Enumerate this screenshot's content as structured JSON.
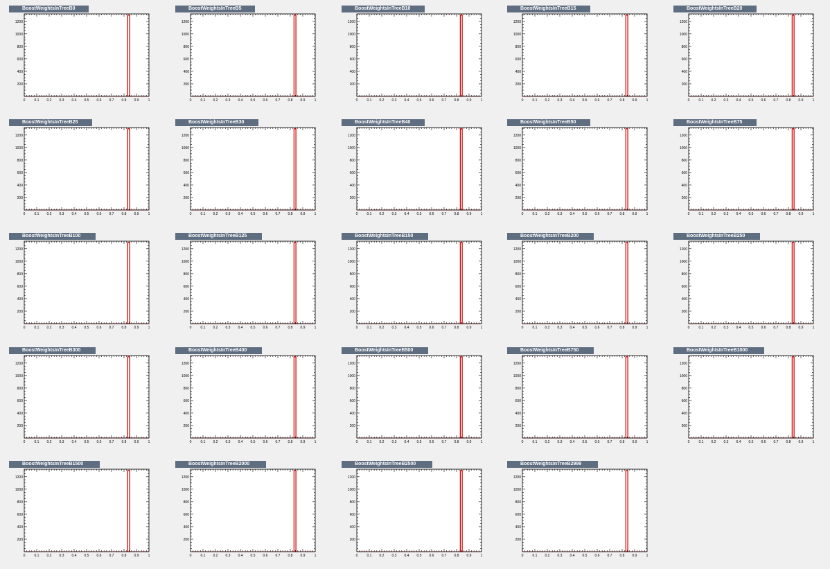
{
  "style": {
    "title_bg": "#5f6d80",
    "title_fg": "#ffffff",
    "frame": "#000000",
    "histogram_line": "#cc0000",
    "baseline": "#cc0000"
  },
  "chart_data": [
    {
      "type": "bar",
      "title": "BoostWeightsInTreeB0",
      "x_ticks": [
        "0",
        "0.1",
        "0.2",
        "0.3",
        "0.4",
        "0.5",
        "0.6",
        "0.7",
        "0.8",
        "0.9",
        "1"
      ],
      "y_ticks": [
        "200",
        "400",
        "600",
        "800",
        "1000",
        "1200"
      ],
      "xlim": [
        0,
        1
      ],
      "ylim": [
        0,
        1320
      ],
      "bins": [
        {
          "x0": 0.83,
          "x1": 0.845,
          "value": 1300
        }
      ]
    },
    {
      "type": "bar",
      "title": "BoostWeightsInTreeB5",
      "x_ticks": [
        "0",
        "0.1",
        "0.2",
        "0.3",
        "0.4",
        "0.5",
        "0.6",
        "0.7",
        "0.8",
        "0.9",
        "1"
      ],
      "y_ticks": [
        "200",
        "400",
        "600",
        "800",
        "1000",
        "1200"
      ],
      "xlim": [
        0,
        1
      ],
      "ylim": [
        0,
        1320
      ],
      "bins": [
        {
          "x0": 0.83,
          "x1": 0.845,
          "value": 1300
        }
      ]
    },
    {
      "type": "bar",
      "title": "BoostWeightsInTreeB10",
      "x_ticks": [
        "0",
        "0.1",
        "0.2",
        "0.3",
        "0.4",
        "0.5",
        "0.6",
        "0.7",
        "0.8",
        "0.9",
        "1"
      ],
      "y_ticks": [
        "200",
        "400",
        "600",
        "800",
        "1000",
        "1200"
      ],
      "xlim": [
        0,
        1
      ],
      "ylim": [
        0,
        1320
      ],
      "bins": [
        {
          "x0": 0.83,
          "x1": 0.845,
          "value": 1300
        }
      ]
    },
    {
      "type": "bar",
      "title": "BoostWeightsInTreeB15",
      "x_ticks": [
        "0",
        "0.1",
        "0.2",
        "0.3",
        "0.4",
        "0.5",
        "0.6",
        "0.7",
        "0.8",
        "0.9",
        "1"
      ],
      "y_ticks": [
        "200",
        "400",
        "600",
        "800",
        "1000",
        "1200"
      ],
      "xlim": [
        0,
        1
      ],
      "ylim": [
        0,
        1320
      ],
      "bins": [
        {
          "x0": 0.83,
          "x1": 0.845,
          "value": 1300
        }
      ]
    },
    {
      "type": "bar",
      "title": "BoostWeightsInTreeB20",
      "x_ticks": [
        "0",
        "0.1",
        "0.2",
        "0.3",
        "0.4",
        "0.5",
        "0.6",
        "0.7",
        "0.8",
        "0.9",
        "1"
      ],
      "y_ticks": [
        "200",
        "400",
        "600",
        "800",
        "1000",
        "1200"
      ],
      "xlim": [
        0,
        1
      ],
      "ylim": [
        0,
        1320
      ],
      "bins": [
        {
          "x0": 0.83,
          "x1": 0.845,
          "value": 1300
        }
      ]
    },
    {
      "type": "bar",
      "title": "BoostWeightsInTreeB25",
      "x_ticks": [
        "0",
        "0.1",
        "0.2",
        "0.3",
        "0.4",
        "0.5",
        "0.6",
        "0.7",
        "0.8",
        "0.9",
        "1"
      ],
      "y_ticks": [
        "200",
        "400",
        "600",
        "800",
        "1000",
        "1200"
      ],
      "xlim": [
        0,
        1
      ],
      "ylim": [
        0,
        1320
      ],
      "bins": [
        {
          "x0": 0.83,
          "x1": 0.845,
          "value": 1300
        }
      ]
    },
    {
      "type": "bar",
      "title": "BoostWeightsInTreeB30",
      "x_ticks": [
        "0",
        "0.1",
        "0.2",
        "0.3",
        "0.4",
        "0.5",
        "0.6",
        "0.7",
        "0.8",
        "0.9",
        "1"
      ],
      "y_ticks": [
        "200",
        "400",
        "600",
        "800",
        "1000",
        "1200"
      ],
      "xlim": [
        0,
        1
      ],
      "ylim": [
        0,
        1320
      ],
      "bins": [
        {
          "x0": 0.83,
          "x1": 0.845,
          "value": 1300
        }
      ]
    },
    {
      "type": "bar",
      "title": "BoostWeightsInTreeB40",
      "x_ticks": [
        "0",
        "0.1",
        "0.2",
        "0.3",
        "0.4",
        "0.5",
        "0.6",
        "0.7",
        "0.8",
        "0.9",
        "1"
      ],
      "y_ticks": [
        "200",
        "400",
        "600",
        "800",
        "1000",
        "1200"
      ],
      "xlim": [
        0,
        1
      ],
      "ylim": [
        0,
        1320
      ],
      "bins": [
        {
          "x0": 0.83,
          "x1": 0.845,
          "value": 1300
        }
      ]
    },
    {
      "type": "bar",
      "title": "BoostWeightsInTreeB50",
      "x_ticks": [
        "0",
        "0.1",
        "0.2",
        "0.3",
        "0.4",
        "0.5",
        "0.6",
        "0.7",
        "0.8",
        "0.9",
        "1"
      ],
      "y_ticks": [
        "200",
        "400",
        "600",
        "800",
        "1000",
        "1200"
      ],
      "xlim": [
        0,
        1
      ],
      "ylim": [
        0,
        1320
      ],
      "bins": [
        {
          "x0": 0.83,
          "x1": 0.845,
          "value": 1300
        }
      ]
    },
    {
      "type": "bar",
      "title": "BoostWeightsInTreeB75",
      "x_ticks": [
        "0",
        "0.1",
        "0.2",
        "0.3",
        "0.4",
        "0.5",
        "0.6",
        "0.7",
        "0.8",
        "0.9",
        "1"
      ],
      "y_ticks": [
        "200",
        "400",
        "600",
        "800",
        "1000",
        "1200"
      ],
      "xlim": [
        0,
        1
      ],
      "ylim": [
        0,
        1320
      ],
      "bins": [
        {
          "x0": 0.83,
          "x1": 0.845,
          "value": 1300
        }
      ]
    },
    {
      "type": "bar",
      "title": "BoostWeightsInTreeB100",
      "x_ticks": [
        "0",
        "0.1",
        "0.2",
        "0.3",
        "0.4",
        "0.5",
        "0.6",
        "0.7",
        "0.8",
        "0.9",
        "1"
      ],
      "y_ticks": [
        "200",
        "400",
        "600",
        "800",
        "1000",
        "1200"
      ],
      "xlim": [
        0,
        1
      ],
      "ylim": [
        0,
        1320
      ],
      "bins": [
        {
          "x0": 0.83,
          "x1": 0.845,
          "value": 1300
        }
      ]
    },
    {
      "type": "bar",
      "title": "BoostWeightsInTreeB125",
      "x_ticks": [
        "0",
        "0.1",
        "0.2",
        "0.3",
        "0.4",
        "0.5",
        "0.6",
        "0.7",
        "0.8",
        "0.9",
        "1"
      ],
      "y_ticks": [
        "200",
        "400",
        "600",
        "800",
        "1000",
        "1200"
      ],
      "xlim": [
        0,
        1
      ],
      "ylim": [
        0,
        1320
      ],
      "bins": [
        {
          "x0": 0.83,
          "x1": 0.845,
          "value": 1300
        }
      ]
    },
    {
      "type": "bar",
      "title": "BoostWeightsInTreeB150",
      "x_ticks": [
        "0",
        "0.1",
        "0.2",
        "0.3",
        "0.4",
        "0.5",
        "0.6",
        "0.7",
        "0.8",
        "0.9",
        "1"
      ],
      "y_ticks": [
        "200",
        "400",
        "600",
        "800",
        "1000",
        "1200"
      ],
      "xlim": [
        0,
        1
      ],
      "ylim": [
        0,
        1320
      ],
      "bins": [
        {
          "x0": 0.83,
          "x1": 0.845,
          "value": 1300
        }
      ]
    },
    {
      "type": "bar",
      "title": "BoostWeightsInTreeB200",
      "x_ticks": [
        "0",
        "0.1",
        "0.2",
        "0.3",
        "0.4",
        "0.5",
        "0.6",
        "0.7",
        "0.8",
        "0.9",
        "1"
      ],
      "y_ticks": [
        "200",
        "400",
        "600",
        "800",
        "1000",
        "1200"
      ],
      "xlim": [
        0,
        1
      ],
      "ylim": [
        0,
        1320
      ],
      "bins": [
        {
          "x0": 0.83,
          "x1": 0.845,
          "value": 1300
        }
      ]
    },
    {
      "type": "bar",
      "title": "BoostWeightsInTreeB250",
      "x_ticks": [
        "0",
        "0.1",
        "0.2",
        "0.3",
        "0.4",
        "0.5",
        "0.6",
        "0.7",
        "0.8",
        "0.9",
        "1"
      ],
      "y_ticks": [
        "200",
        "400",
        "600",
        "800",
        "1000",
        "1200"
      ],
      "xlim": [
        0,
        1
      ],
      "ylim": [
        0,
        1320
      ],
      "bins": [
        {
          "x0": 0.83,
          "x1": 0.845,
          "value": 1300
        }
      ]
    },
    {
      "type": "bar",
      "title": "BoostWeightsInTreeB300",
      "x_ticks": [
        "0",
        "0.1",
        "0.2",
        "0.3",
        "0.4",
        "0.5",
        "0.6",
        "0.7",
        "0.8",
        "0.9",
        "1"
      ],
      "y_ticks": [
        "200",
        "400",
        "600",
        "800",
        "1000",
        "1200"
      ],
      "xlim": [
        0,
        1
      ],
      "ylim": [
        0,
        1320
      ],
      "bins": [
        {
          "x0": 0.83,
          "x1": 0.845,
          "value": 1300
        }
      ]
    },
    {
      "type": "bar",
      "title": "BoostWeightsInTreeB400",
      "x_ticks": [
        "0",
        "0.1",
        "0.2",
        "0.3",
        "0.4",
        "0.5",
        "0.6",
        "0.7",
        "0.8",
        "0.9",
        "1"
      ],
      "y_ticks": [
        "200",
        "400",
        "600",
        "800",
        "1000",
        "1200"
      ],
      "xlim": [
        0,
        1
      ],
      "ylim": [
        0,
        1320
      ],
      "bins": [
        {
          "x0": 0.83,
          "x1": 0.845,
          "value": 1300
        }
      ]
    },
    {
      "type": "bar",
      "title": "BoostWeightsInTreeB500",
      "x_ticks": [
        "0",
        "0.1",
        "0.2",
        "0.3",
        "0.4",
        "0.5",
        "0.6",
        "0.7",
        "0.8",
        "0.9",
        "1"
      ],
      "y_ticks": [
        "200",
        "400",
        "600",
        "800",
        "1000",
        "1200"
      ],
      "xlim": [
        0,
        1
      ],
      "ylim": [
        0,
        1320
      ],
      "bins": [
        {
          "x0": 0.83,
          "x1": 0.845,
          "value": 1300
        }
      ]
    },
    {
      "type": "bar",
      "title": "BoostWeightsInTreeB750",
      "x_ticks": [
        "0",
        "0.1",
        "0.2",
        "0.3",
        "0.4",
        "0.5",
        "0.6",
        "0.7",
        "0.8",
        "0.9",
        "1"
      ],
      "y_ticks": [
        "200",
        "400",
        "600",
        "800",
        "1000",
        "1200"
      ],
      "xlim": [
        0,
        1
      ],
      "ylim": [
        0,
        1320
      ],
      "bins": [
        {
          "x0": 0.83,
          "x1": 0.845,
          "value": 1300
        }
      ]
    },
    {
      "type": "bar",
      "title": "BoostWeightsInTreeB1000",
      "x_ticks": [
        "0",
        "0.1",
        "0.2",
        "0.3",
        "0.4",
        "0.5",
        "0.6",
        "0.7",
        "0.8",
        "0.9",
        "1"
      ],
      "y_ticks": [
        "200",
        "400",
        "600",
        "800",
        "1000",
        "1200"
      ],
      "xlim": [
        0,
        1
      ],
      "ylim": [
        0,
        1320
      ],
      "bins": [
        {
          "x0": 0.83,
          "x1": 0.845,
          "value": 1300
        }
      ]
    },
    {
      "type": "bar",
      "title": "BoostWeightsInTreeB1500",
      "x_ticks": [
        "0",
        "0.1",
        "0.2",
        "0.3",
        "0.4",
        "0.5",
        "0.6",
        "0.7",
        "0.8",
        "0.9",
        "1"
      ],
      "y_ticks": [
        "200",
        "400",
        "600",
        "800",
        "1000",
        "1200"
      ],
      "xlim": [
        0,
        1
      ],
      "ylim": [
        0,
        1320
      ],
      "bins": [
        {
          "x0": 0.83,
          "x1": 0.845,
          "value": 1300
        }
      ]
    },
    {
      "type": "bar",
      "title": "BoostWeightsInTreeB2000",
      "x_ticks": [
        "0",
        "0.1",
        "0.2",
        "0.3",
        "0.4",
        "0.5",
        "0.6",
        "0.7",
        "0.8",
        "0.9",
        "1"
      ],
      "y_ticks": [
        "200",
        "400",
        "600",
        "800",
        "1000",
        "1200"
      ],
      "xlim": [
        0,
        1
      ],
      "ylim": [
        0,
        1320
      ],
      "bins": [
        {
          "x0": 0.83,
          "x1": 0.845,
          "value": 1300
        }
      ]
    },
    {
      "type": "bar",
      "title": "BoostWeightsInTreeB2500",
      "x_ticks": [
        "0",
        "0.1",
        "0.2",
        "0.3",
        "0.4",
        "0.5",
        "0.6",
        "0.7",
        "0.8",
        "0.9",
        "1"
      ],
      "y_ticks": [
        "200",
        "400",
        "600",
        "800",
        "1000",
        "1200"
      ],
      "xlim": [
        0,
        1
      ],
      "ylim": [
        0,
        1320
      ],
      "bins": [
        {
          "x0": 0.83,
          "x1": 0.845,
          "value": 1300
        }
      ]
    },
    {
      "type": "bar",
      "title": "BoostWeightsInTreeB2999",
      "x_ticks": [
        "0",
        "0.1",
        "0.2",
        "0.3",
        "0.4",
        "0.5",
        "0.6",
        "0.7",
        "0.8",
        "0.9",
        "1"
      ],
      "y_ticks": [
        "200",
        "400",
        "600",
        "800",
        "1000",
        "1200"
      ],
      "xlim": [
        0,
        1
      ],
      "ylim": [
        0,
        1320
      ],
      "bins": [
        {
          "x0": 0.83,
          "x1": 0.845,
          "value": 1300
        }
      ]
    }
  ]
}
